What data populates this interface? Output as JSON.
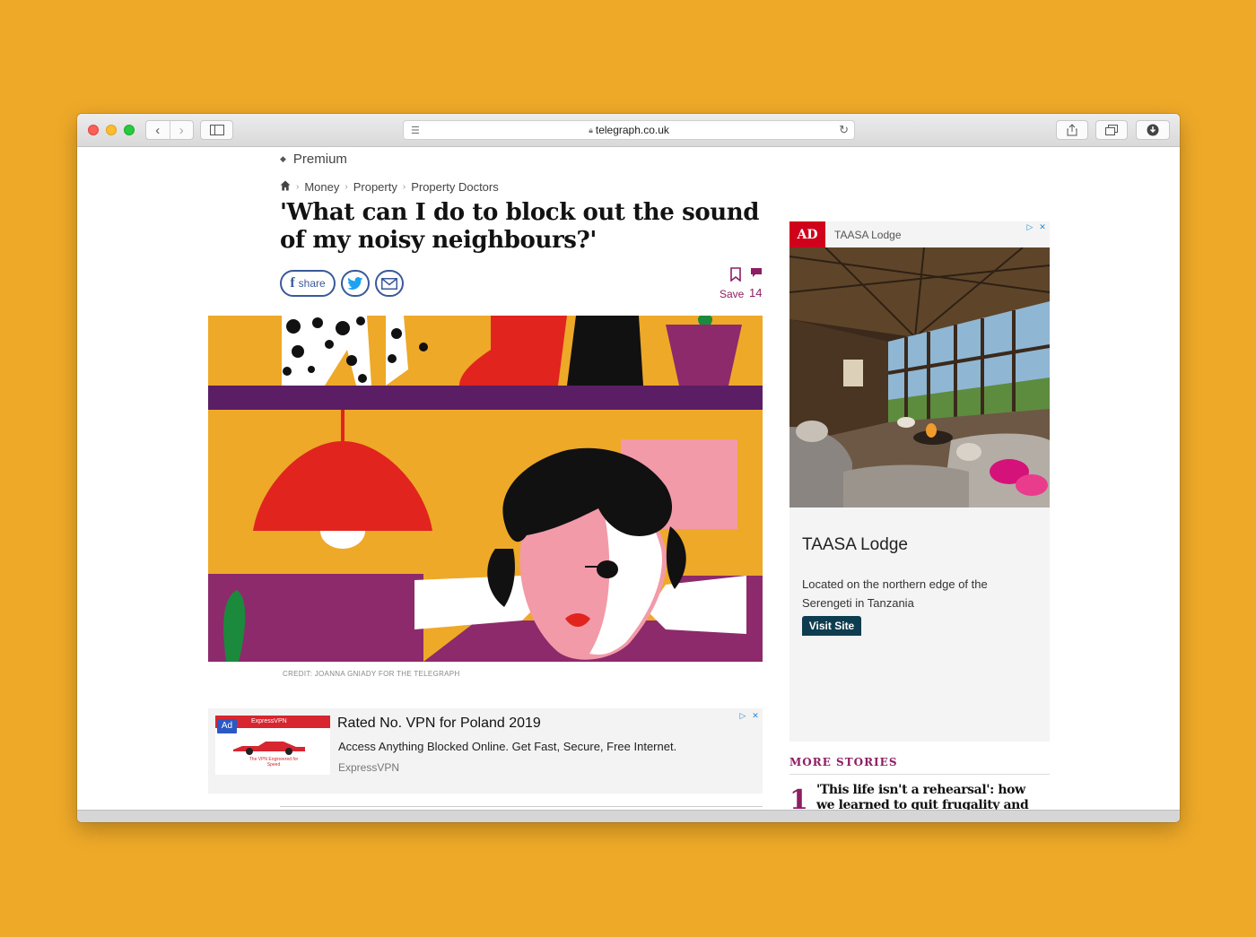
{
  "browser": {
    "url": "telegraph.co.uk"
  },
  "article": {
    "label": "Premium",
    "breadcrumb": [
      "Money",
      "Property",
      "Property Doctors"
    ],
    "headline": "'What can I do to block out the sound of my noisy neighbours?'",
    "share_label": "share",
    "save_label": "Save",
    "comment_count": "14",
    "image_credit": "CREDIT: JOANNA GNIADY FOR THE TELEGRAPH"
  },
  "bottom_ad": {
    "tag": "Ad",
    "brand_header": "ExpressVPN",
    "thumb_text": "The VPN Engineered for Speed",
    "title": "Rated No. VPN for Poland 2019",
    "description": "Access Anything Blocked Online. Get Fast, Secure, Free Internet.",
    "advertiser": "ExpressVPN"
  },
  "side_ad": {
    "label": "AD",
    "advertiser": "TAASA Lodge",
    "title": "TAASA Lodge",
    "description": "Located on the northern edge of the Serengeti in Tanzania",
    "button": "Visit Site"
  },
  "more_stories": {
    "header": "MORE STORIES",
    "items": [
      {
        "number": "1",
        "title": "'This life isn't a rehearsal': how we learned to quit frugality and enjoy"
      }
    ]
  },
  "colors": {
    "background": "#EEA928",
    "brand_accent": "#8e1e63",
    "ad_red": "#d0021b"
  }
}
